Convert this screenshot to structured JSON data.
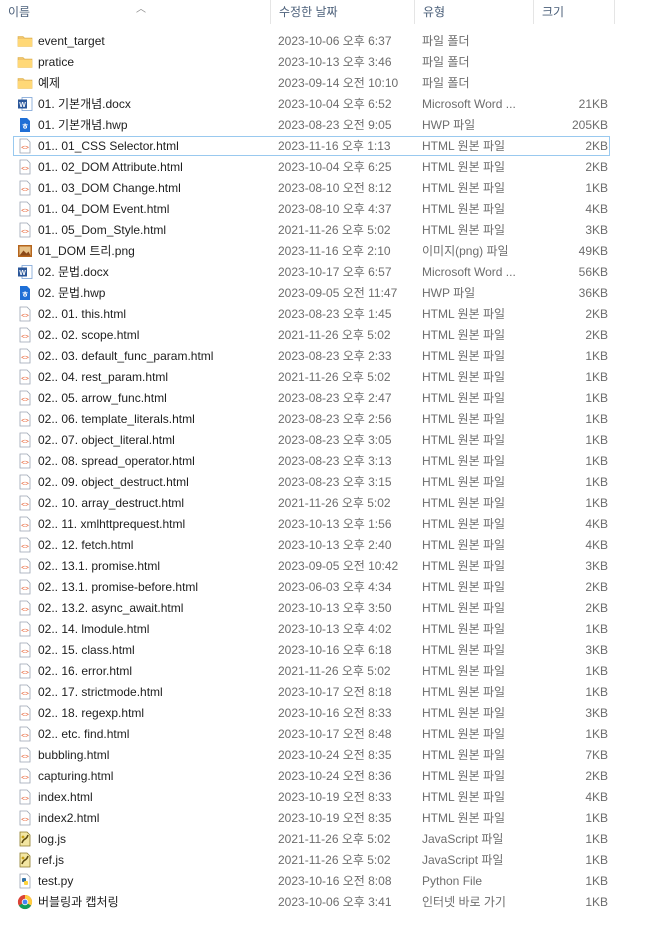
{
  "columns": {
    "name": "이름",
    "date": "수정한 날짜",
    "type": "유형",
    "size": "크기"
  },
  "colors": {
    "header_text": "#4c607a",
    "folder": "#f2c66d",
    "word": "#2b579a",
    "hwp": "#1f6fd6",
    "html": "#e4501e",
    "png": "#b5651d",
    "js": "#c9a21a",
    "selection_border": "#99c9ef"
  },
  "files": [
    {
      "name": "event_target",
      "date": "2023-10-06 오후 6:37",
      "type": "파일 폴더",
      "size": "",
      "icon": "folder-icon"
    },
    {
      "name": "pratice",
      "date": "2023-10-13 오후 3:46",
      "type": "파일 폴더",
      "size": "",
      "icon": "folder-icon"
    },
    {
      "name": "예제",
      "date": "2023-09-14 오전 10:10",
      "type": "파일 폴더",
      "size": "",
      "icon": "folder-icon"
    },
    {
      "name": "01. 기본개념.docx",
      "date": "2023-10-04 오후 6:52",
      "type": "Microsoft Word ...",
      "size": "21KB",
      "icon": "word-icon"
    },
    {
      "name": "01. 기본개념.hwp",
      "date": "2023-08-23 오전 9:05",
      "type": "HWP 파일",
      "size": "205KB",
      "icon": "hwp-icon"
    },
    {
      "name": "01.. 01_CSS Selector.html",
      "date": "2023-11-16 오후 1:13",
      "type": "HTML 원본 파일",
      "size": "2KB",
      "icon": "html-icon",
      "selected": true
    },
    {
      "name": "01.. 02_DOM Attribute.html",
      "date": "2023-10-04 오후 6:25",
      "type": "HTML 원본 파일",
      "size": "2KB",
      "icon": "html-icon"
    },
    {
      "name": "01.. 03_DOM Change.html",
      "date": "2023-08-10 오전 8:12",
      "type": "HTML 원본 파일",
      "size": "1KB",
      "icon": "html-icon"
    },
    {
      "name": "01.. 04_DOM Event.html",
      "date": "2023-08-10 오후 4:37",
      "type": "HTML 원본 파일",
      "size": "4KB",
      "icon": "html-icon"
    },
    {
      "name": "01.. 05_Dom_Style.html",
      "date": "2021-11-26 오후 5:02",
      "type": "HTML 원본 파일",
      "size": "3KB",
      "icon": "html-icon"
    },
    {
      "name": "01_DOM 트리.png",
      "date": "2023-11-16 오후 2:10",
      "type": "이미지(png) 파일",
      "size": "49KB",
      "icon": "png-icon"
    },
    {
      "name": "02. 문법.docx",
      "date": "2023-10-17 오후 6:57",
      "type": "Microsoft Word ...",
      "size": "56KB",
      "icon": "word-icon"
    },
    {
      "name": "02. 문법.hwp",
      "date": "2023-09-05 오전 11:47",
      "type": "HWP 파일",
      "size": "36KB",
      "icon": "hwp-icon"
    },
    {
      "name": "02.. 01. this.html",
      "date": "2023-08-23 오후 1:45",
      "type": "HTML 원본 파일",
      "size": "2KB",
      "icon": "html-icon"
    },
    {
      "name": "02.. 02. scope.html",
      "date": "2021-11-26 오후 5:02",
      "type": "HTML 원본 파일",
      "size": "2KB",
      "icon": "html-icon"
    },
    {
      "name": "02.. 03. default_func_param.html",
      "date": "2023-08-23 오후 2:33",
      "type": "HTML 원본 파일",
      "size": "1KB",
      "icon": "html-icon"
    },
    {
      "name": "02.. 04. rest_param.html",
      "date": "2021-11-26 오후 5:02",
      "type": "HTML 원본 파일",
      "size": "1KB",
      "icon": "html-icon"
    },
    {
      "name": "02.. 05. arrow_func.html",
      "date": "2023-08-23 오후 2:47",
      "type": "HTML 원본 파일",
      "size": "1KB",
      "icon": "html-icon"
    },
    {
      "name": "02.. 06. template_literals.html",
      "date": "2023-08-23 오후 2:56",
      "type": "HTML 원본 파일",
      "size": "1KB",
      "icon": "html-icon"
    },
    {
      "name": "02.. 07. object_literal.html",
      "date": "2023-08-23 오후 3:05",
      "type": "HTML 원본 파일",
      "size": "1KB",
      "icon": "html-icon"
    },
    {
      "name": "02.. 08. spread_operator.html",
      "date": "2023-08-23 오후 3:13",
      "type": "HTML 원본 파일",
      "size": "1KB",
      "icon": "html-icon"
    },
    {
      "name": "02.. 09. object_destruct.html",
      "date": "2023-08-23 오후 3:15",
      "type": "HTML 원본 파일",
      "size": "1KB",
      "icon": "html-icon"
    },
    {
      "name": "02.. 10. array_destruct.html",
      "date": "2021-11-26 오후 5:02",
      "type": "HTML 원본 파일",
      "size": "1KB",
      "icon": "html-icon"
    },
    {
      "name": "02.. 11. xmlhttprequest.html",
      "date": "2023-10-13 오후 1:56",
      "type": "HTML 원본 파일",
      "size": "4KB",
      "icon": "html-icon"
    },
    {
      "name": "02.. 12. fetch.html",
      "date": "2023-10-13 오후 2:40",
      "type": "HTML 원본 파일",
      "size": "4KB",
      "icon": "html-icon"
    },
    {
      "name": "02.. 13.1. promise.html",
      "date": "2023-09-05 오전 10:42",
      "type": "HTML 원본 파일",
      "size": "3KB",
      "icon": "html-icon"
    },
    {
      "name": "02.. 13.1. promise-before.html",
      "date": "2023-06-03 오후 4:34",
      "type": "HTML 원본 파일",
      "size": "2KB",
      "icon": "html-icon"
    },
    {
      "name": "02.. 13.2. async_await.html",
      "date": "2023-10-13 오후 3:50",
      "type": "HTML 원본 파일",
      "size": "2KB",
      "icon": "html-icon"
    },
    {
      "name": "02.. 14. lmodule.html",
      "date": "2023-10-13 오후 4:02",
      "type": "HTML 원본 파일",
      "size": "1KB",
      "icon": "html-icon"
    },
    {
      "name": "02.. 15. class.html",
      "date": "2023-10-16 오후 6:18",
      "type": "HTML 원본 파일",
      "size": "3KB",
      "icon": "html-icon"
    },
    {
      "name": "02.. 16. error.html",
      "date": "2021-11-26 오후 5:02",
      "type": "HTML 원본 파일",
      "size": "1KB",
      "icon": "html-icon"
    },
    {
      "name": "02.. 17. strictmode.html",
      "date": "2023-10-17 오전 8:18",
      "type": "HTML 원본 파일",
      "size": "1KB",
      "icon": "html-icon"
    },
    {
      "name": "02.. 18. regexp.html",
      "date": "2023-10-16 오전 8:33",
      "type": "HTML 원본 파일",
      "size": "3KB",
      "icon": "html-icon"
    },
    {
      "name": "02.. etc. find.html",
      "date": "2023-10-17 오전 8:48",
      "type": "HTML 원본 파일",
      "size": "1KB",
      "icon": "html-icon"
    },
    {
      "name": "bubbling.html",
      "date": "2023-10-24 오전 8:35",
      "type": "HTML 원본 파일",
      "size": "7KB",
      "icon": "html-icon"
    },
    {
      "name": "capturing.html",
      "date": "2023-10-24 오전 8:36",
      "type": "HTML 원본 파일",
      "size": "2KB",
      "icon": "html-icon"
    },
    {
      "name": "index.html",
      "date": "2023-10-19 오전 8:33",
      "type": "HTML 원본 파일",
      "size": "4KB",
      "icon": "html-icon"
    },
    {
      "name": "index2.html",
      "date": "2023-10-19 오전 8:35",
      "type": "HTML 원본 파일",
      "size": "1KB",
      "icon": "html-icon"
    },
    {
      "name": "log.js",
      "date": "2021-11-26 오후 5:02",
      "type": "JavaScript 파일",
      "size": "1KB",
      "icon": "js-icon"
    },
    {
      "name": "ref.js",
      "date": "2021-11-26 오후 5:02",
      "type": "JavaScript 파일",
      "size": "1KB",
      "icon": "js-icon"
    },
    {
      "name": "test.py",
      "date": "2023-10-16 오전 8:08",
      "type": "Python File",
      "size": "1KB",
      "icon": "py-icon"
    },
    {
      "name": "버블링과 캡처링",
      "date": "2023-10-06 오후 3:41",
      "type": "인터넷 바로 가기",
      "size": "1KB",
      "icon": "chrome-icon"
    }
  ]
}
